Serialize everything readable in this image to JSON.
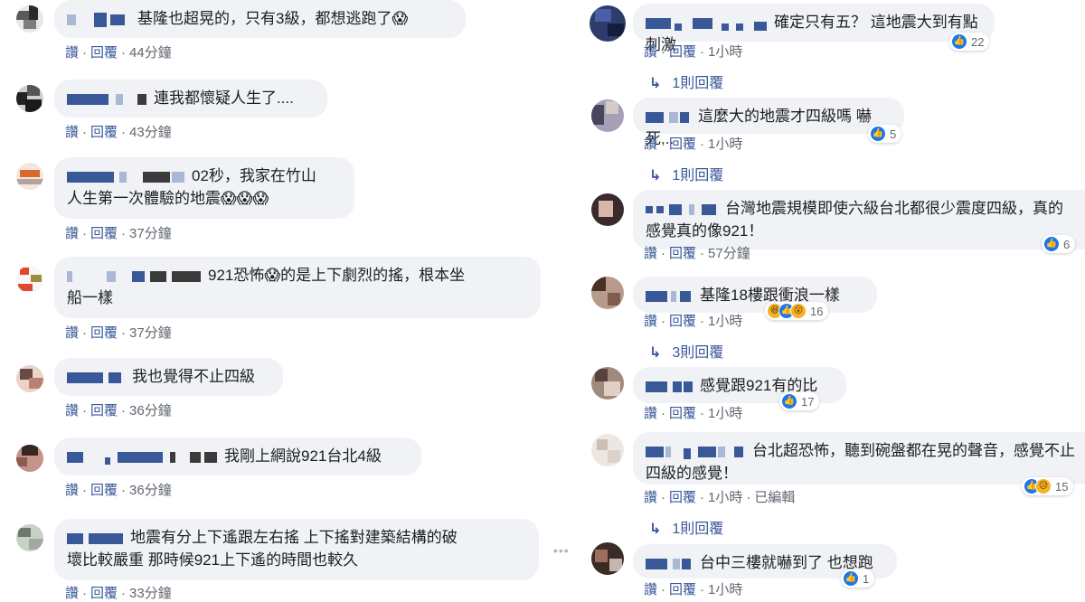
{
  "actions": {
    "like_label": "讚",
    "reply_label": "回覆",
    "edited_label": "已編輯"
  },
  "left_comments": [
    {
      "text": "基隆也超晃的，只有3級，都想逃跑了😱",
      "time": "44分鐘"
    },
    {
      "text": "連我都懷疑人生了....",
      "time": "43分鐘"
    },
    {
      "text": "02秒，我家在竹山",
      "text2": "人生第一次體驗的地震😱😱😱",
      "time": "37分鐘"
    },
    {
      "text": "921恐怖😱的是上下劇烈的搖，根本坐",
      "text2": "船一樣",
      "time": "37分鐘"
    },
    {
      "text": "我也覺得不止四級",
      "time": "36分鐘"
    },
    {
      "text": "我剛上網說921台北4級",
      "time": "36分鐘"
    },
    {
      "text": "地震有分上下遙跟左右搖 上下搖對建築結構的破",
      "text2": "壞比較嚴重 那時候921上下遙的時間也較久",
      "time": "33分鐘"
    }
  ],
  "right_comments": [
    {
      "text": "確定只有五？ 這地震大到有點刺激",
      "time": "1小時",
      "reactions": [
        "like"
      ],
      "count": "22",
      "replies": "1則回覆"
    },
    {
      "text": "這麼大的地震才四級嗎 嚇死...",
      "time": "1小時",
      "reactions": [
        "like"
      ],
      "count": "5",
      "replies": "1則回覆"
    },
    {
      "text": "台灣地震規模即使六級台北都很少震度四級，真的",
      "text2": "感覺真的像921！",
      "time": "57分鐘",
      "reactions": [
        "like"
      ],
      "count": "6"
    },
    {
      "text": "基隆18樓跟衝浪一樣",
      "time": "1小時",
      "reactions": [
        "haha",
        "like",
        "wow"
      ],
      "count": "16",
      "replies": "3則回覆"
    },
    {
      "text": "感覺跟921有的比",
      "time": "1小時",
      "reactions": [
        "like"
      ],
      "count": "17"
    },
    {
      "text": "台北超恐怖，聽到碗盤都在晃的聲音，感覺不止",
      "text2": "四級的感覺！",
      "time": "1小時",
      "edited": true,
      "reactions": [
        "like",
        "sad"
      ],
      "count": "15",
      "replies": "1則回覆"
    },
    {
      "text": "台中三樓就嚇到了 也想跑",
      "time": "1小時",
      "reactions": [
        "like"
      ],
      "count": "1"
    }
  ],
  "icons": {
    "reply_arrow": "reply-arrow-icon",
    "more": "more-options-icon"
  },
  "colors": {
    "link": "#385898",
    "bubble": "#f0f2f5",
    "like": "#1877f2",
    "meta": "#606770"
  }
}
